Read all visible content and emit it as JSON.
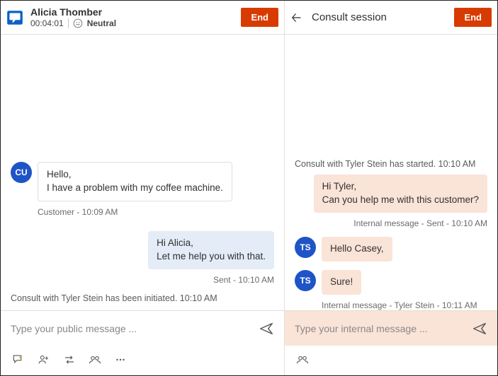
{
  "left": {
    "customer_name": "Alicia Thomber",
    "timer": "00:04:01",
    "sentiment": "Neutral",
    "end_label": "End",
    "messages": {
      "m1l1": "Hello,",
      "m1l2": "I have a problem with my coffee machine.",
      "m1meta": "Customer - 10:09 AM",
      "m2l1": "Hi Alicia,",
      "m2l2": "Let me help you with that.",
      "m2meta": "Sent - 10:10 AM",
      "sys1": "Consult with Tyler Stein has been initiated. 10:10 AM"
    },
    "avatar": "CU",
    "composer_placeholder": "Type your public message ..."
  },
  "right": {
    "title": "Consult session",
    "end_label": "End",
    "sys1": "Consult with Tyler Stein has started. 10:10 AM",
    "m1l1": "Hi Tyler,",
    "m1l2": "Can you help me with this customer?",
    "m1meta": "Internal message - Sent - 10:10 AM",
    "m2": "Hello Casey,",
    "m3": "Sure!",
    "m3meta": "Internal message - Tyler Stein - 10:11 AM",
    "avatar": "TS",
    "composer_placeholder": "Type your internal message ..."
  }
}
